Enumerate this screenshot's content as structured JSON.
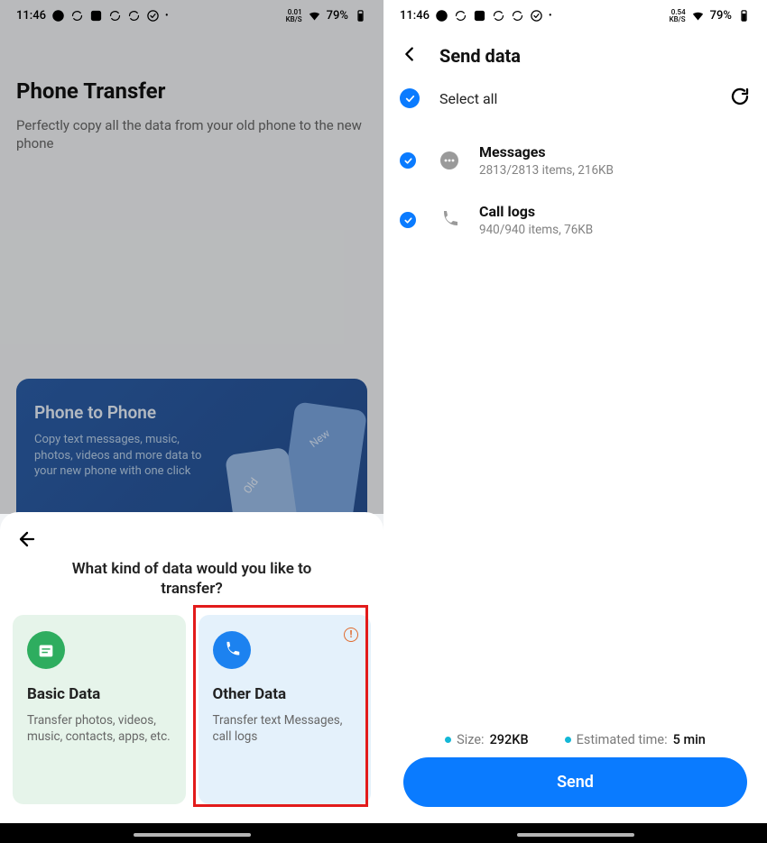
{
  "status": {
    "time": "11:46",
    "net_left": "0.01",
    "net_right": "0.54",
    "net_unit": "KB/S",
    "battery": "79%"
  },
  "left": {
    "title": "Phone Transfer",
    "subtitle": "Perfectly copy all the data from your old phone to the new phone",
    "p2p": {
      "title": "Phone to Phone",
      "subtitle": "Copy text messages, music, photos, videos and more data to your new phone with one click"
    },
    "sheet": {
      "title": "What kind of data would you like to transfer?",
      "basic": {
        "title": "Basic Data",
        "sub": "Transfer photos, videos, music, contacts, apps, etc."
      },
      "other": {
        "title": "Other Data",
        "sub": "Transfer text Messages, call logs"
      }
    }
  },
  "right": {
    "title": "Send data",
    "select_all": "Select all",
    "items": [
      {
        "title": "Messages",
        "sub": "2813/2813 items, 216KB"
      },
      {
        "title": "Call logs",
        "sub": "940/940 items, 76KB"
      }
    ],
    "footer": {
      "size_label": "Size:",
      "size_value": "292KB",
      "eta_label": "Estimated time:",
      "eta_value": "5 min"
    },
    "send": "Send"
  }
}
